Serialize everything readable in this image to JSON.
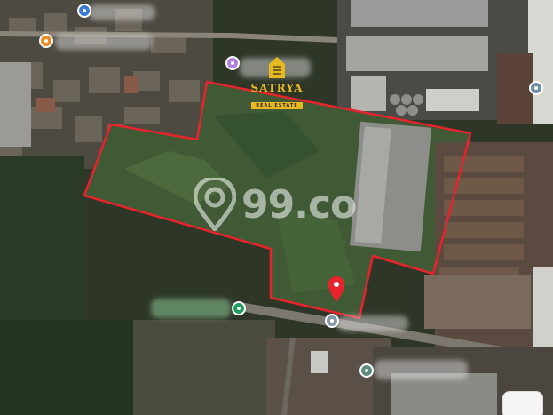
{
  "map": {
    "watermark": "99.co",
    "logo": {
      "name": "SATRYA",
      "subtitle": "REAL ESTATE"
    },
    "pins": [
      {
        "name": "place-pin-1",
        "color": "#3a7bd5"
      },
      {
        "name": "place-pin-2",
        "color": "#f08a24"
      },
      {
        "name": "place-pin-3",
        "color": "#b37fe3"
      },
      {
        "name": "place-pin-4",
        "color": "#6f8fa8"
      },
      {
        "name": "place-pin-5",
        "color": "#1e9e5a"
      },
      {
        "name": "place-pin-6",
        "color": "#8899aa"
      },
      {
        "name": "place-pin-7",
        "color": "#5f8a7e"
      }
    ],
    "boundary_color": "#e8232b",
    "marker_color": "#e8232b"
  }
}
